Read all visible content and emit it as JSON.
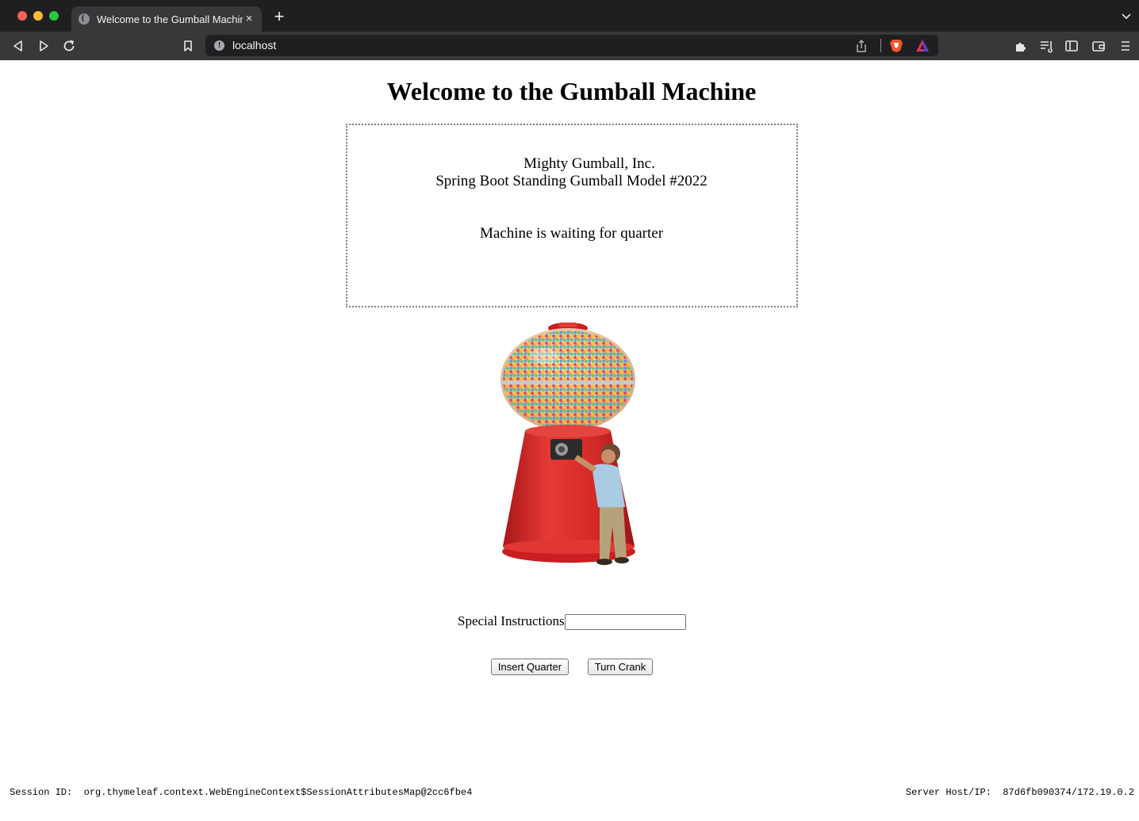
{
  "browser": {
    "tab_title": "Welcome to the Gumball Machine",
    "tab_close": "×",
    "new_tab": "+",
    "url": "localhost",
    "info_glyph": "!",
    "icons": [
      "back-icon",
      "forward-icon",
      "reload-icon",
      "bookmark-icon",
      "share-icon",
      "brave-shields-icon",
      "brave-rewards-icon",
      "extensions-icon",
      "reading-list-icon",
      "sidebar-icon",
      "wallet-icon",
      "menu-icon"
    ]
  },
  "page": {
    "title": "Welcome to the Gumball Machine",
    "company": "Mighty Gumball, Inc.",
    "model": "Spring Boot Standing Gumball Model #2022",
    "machine_state": "Machine is waiting for quarter",
    "instructions_label": "Special Instructions:",
    "instructions_value": "",
    "insert_quarter_label": "Insert Quarter",
    "turn_crank_label": "Turn Crank"
  },
  "footer": {
    "session_label": "Session ID:",
    "session_value": "org.thymeleaf.context.WebEngineContext$SessionAttributesMap@2cc6fbe4",
    "server_label": "Server Host/IP:",
    "server_value": "87d6fb090374/172.19.0.2"
  },
  "colors": {
    "machine_red": "#d42d2a",
    "chrome_dark": "#1f1f21",
    "toolbar": "#38383b"
  }
}
